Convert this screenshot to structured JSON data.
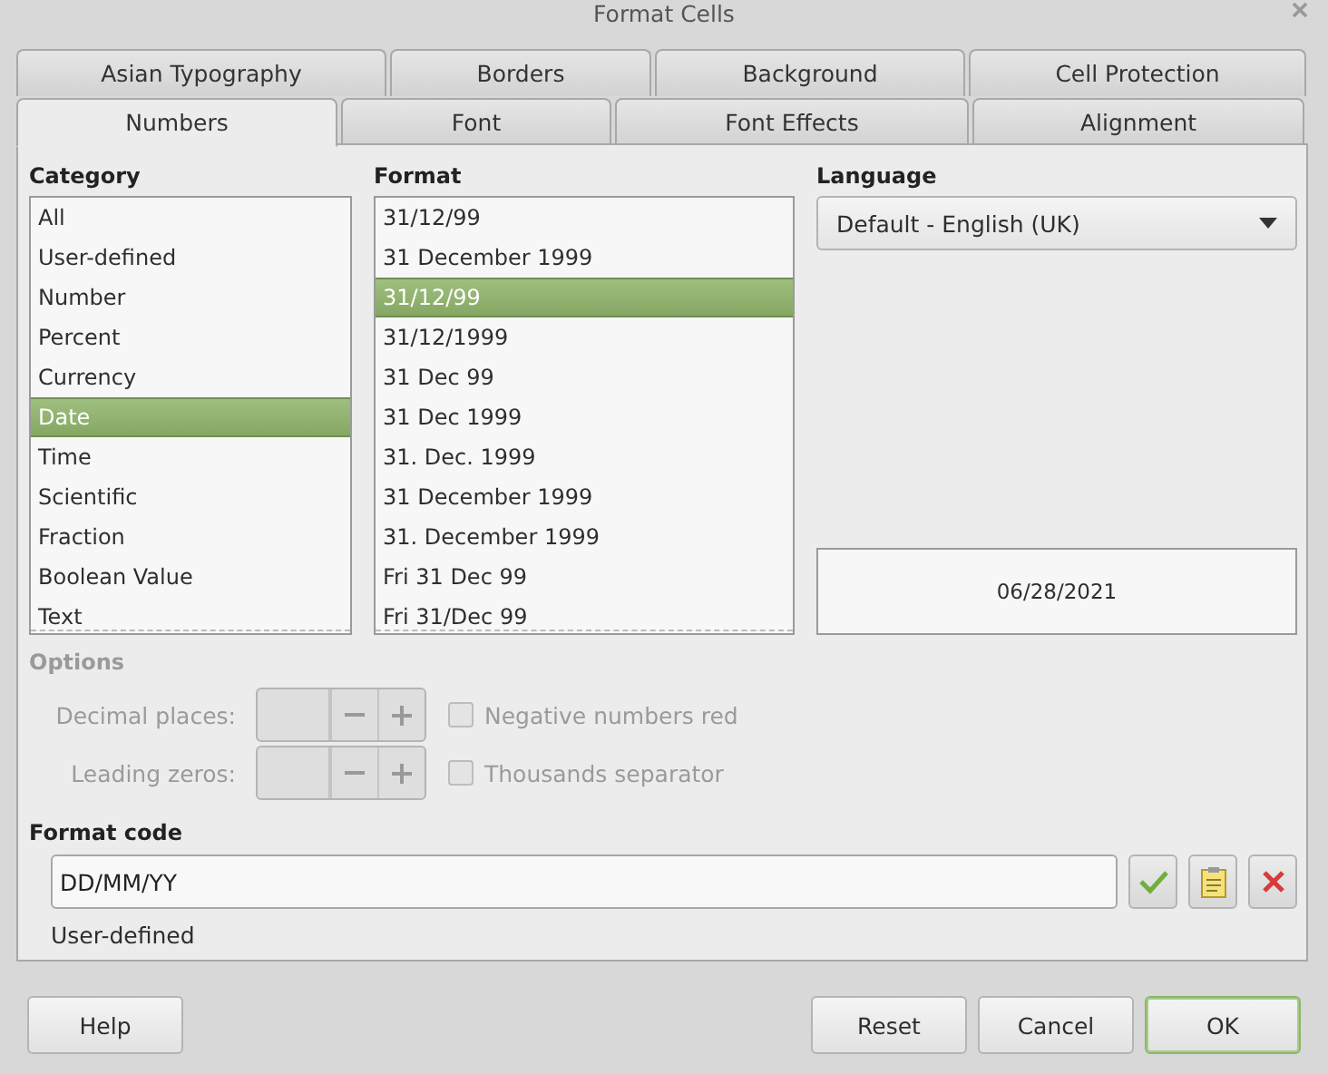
{
  "window": {
    "title": "Format Cells"
  },
  "tab_rows": [
    [
      {
        "label": "Asian Typography",
        "selected": false
      },
      {
        "label": "Borders",
        "selected": false
      },
      {
        "label": "Background",
        "selected": false
      },
      {
        "label": "Cell Protection",
        "selected": false
      }
    ],
    [
      {
        "label": "Numbers",
        "selected": true
      },
      {
        "label": "Font",
        "selected": false
      },
      {
        "label": "Font Effects",
        "selected": false
      },
      {
        "label": "Alignment",
        "selected": false
      }
    ]
  ],
  "category": {
    "label": "Category",
    "items": [
      {
        "label": "All",
        "selected": false
      },
      {
        "label": "User-defined",
        "selected": false
      },
      {
        "label": "Number",
        "selected": false
      },
      {
        "label": "Percent",
        "selected": false
      },
      {
        "label": "Currency",
        "selected": false
      },
      {
        "label": "Date",
        "selected": true
      },
      {
        "label": "Time",
        "selected": false
      },
      {
        "label": "Scientific",
        "selected": false
      },
      {
        "label": "Fraction",
        "selected": false
      },
      {
        "label": "Boolean Value",
        "selected": false
      },
      {
        "label": "Text",
        "selected": false
      }
    ]
  },
  "format": {
    "label": "Format",
    "items": [
      {
        "label": "31/12/99",
        "selected": false
      },
      {
        "label": "31 December 1999",
        "selected": false
      },
      {
        "label": "31/12/99",
        "selected": true
      },
      {
        "label": "31/12/1999",
        "selected": false
      },
      {
        "label": "31 Dec 99",
        "selected": false
      },
      {
        "label": "31 Dec 1999",
        "selected": false
      },
      {
        "label": "31. Dec. 1999",
        "selected": false
      },
      {
        "label": "31 December 1999",
        "selected": false
      },
      {
        "label": "31. December 1999",
        "selected": false
      },
      {
        "label": "Fri 31 Dec 99",
        "selected": false
      },
      {
        "label": "Fri 31/Dec 99",
        "selected": false
      }
    ]
  },
  "language": {
    "label": "Language",
    "value": "Default - English (UK)"
  },
  "preview": "06/28/2021",
  "options": {
    "label": "Options",
    "disabled": true,
    "spinners": [
      {
        "label": "Decimal places:",
        "disabled": true
      },
      {
        "label": "Leading zeros:",
        "disabled": true
      }
    ],
    "checkboxes": [
      {
        "label": "Negative numbers red",
        "checked": false,
        "disabled": true
      },
      {
        "label": "Thousands separator",
        "checked": false,
        "disabled": true
      }
    ]
  },
  "format_code": {
    "label": "Format code",
    "value": "DD/MM/YY",
    "description": "User-defined"
  },
  "buttons": [
    {
      "label": "Help",
      "default": false
    },
    {
      "label": "Reset",
      "default": false
    },
    {
      "label": "Cancel",
      "default": false
    },
    {
      "label": "OK",
      "default": true
    }
  ]
}
